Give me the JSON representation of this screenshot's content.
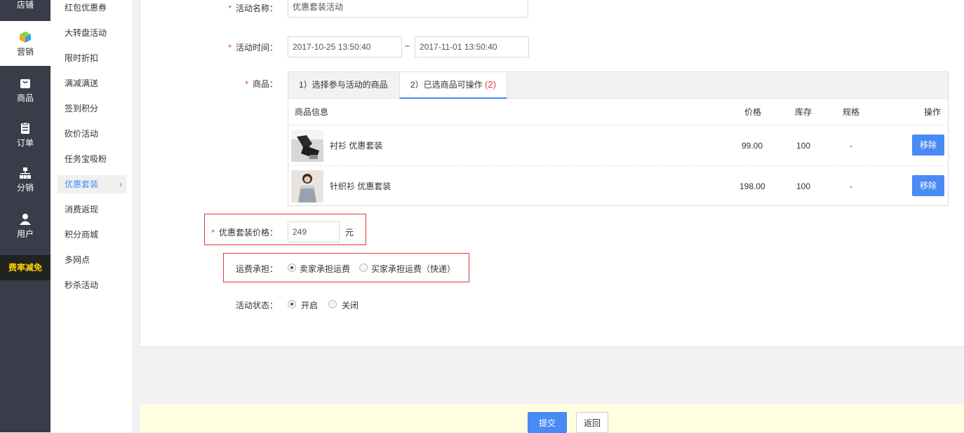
{
  "nav": {
    "items": [
      {
        "label": "店铺",
        "icon": "store-icon"
      },
      {
        "label": "营销",
        "icon": "marketing-cube-icon"
      },
      {
        "label": "商品",
        "icon": "goods-bag-icon"
      },
      {
        "label": "订单",
        "icon": "order-clipboard-icon"
      },
      {
        "label": "分销",
        "icon": "distribution-tree-icon"
      },
      {
        "label": "用户",
        "icon": "user-icon"
      }
    ],
    "promo": "费率减免",
    "promo_color": "#ffd400"
  },
  "submenu": {
    "items": [
      "红包优惠券",
      "大转盘活动",
      "限时折扣",
      "满减满送",
      "签到积分",
      "砍价活动",
      "任务宝吸粉",
      "优惠套装",
      "消费返现",
      "积分商城",
      "多网点",
      "秒杀活动"
    ],
    "active": "优惠套装",
    "active_arrow": "›"
  },
  "form": {
    "required_mark": "*",
    "name_label": "活动名称：",
    "name_value": "优惠套装活动",
    "time_label": "活动时间：",
    "start_time": "2017-10-25 13:50:40",
    "time_sep": "~",
    "end_time": "2017-11-01 13:50:40",
    "goods_label": "商品：",
    "tabs": {
      "tab1": "1）选择参与活动的商品",
      "tab2": "2）已选商品可操作",
      "tab2_count": "(2)"
    },
    "table": {
      "headers": {
        "info": "商品信息",
        "price": "价格",
        "stock": "库存",
        "spec": "规格",
        "action": "操作"
      },
      "rows": [
        {
          "name": "衬衫 优惠套装",
          "price": "99.00",
          "stock": "100",
          "spec": "-",
          "action": "移除"
        },
        {
          "name": "针织衫 优惠套装",
          "price": "198.00",
          "stock": "100",
          "spec": "-",
          "action": "移除"
        }
      ]
    },
    "bundle_price_label": "优惠套装价格：",
    "bundle_price_value": "249",
    "bundle_price_unit": "元",
    "shipping_label": "运费承担：",
    "shipping_options": [
      "卖家承担运费",
      "买家承担运费（快递）"
    ],
    "shipping_selected": "卖家承担运费",
    "status_label": "活动状态：",
    "status_options": [
      "开启",
      "关闭"
    ],
    "status_selected": "开启"
  },
  "footer": {
    "submit": "提交",
    "back": "返回"
  },
  "colors": {
    "primary": "#4a8af4",
    "required": "#e4393c",
    "highlight_border": "#e03a3a",
    "nav_bg": "#393d49",
    "footer_bg": "#ffffe0"
  }
}
